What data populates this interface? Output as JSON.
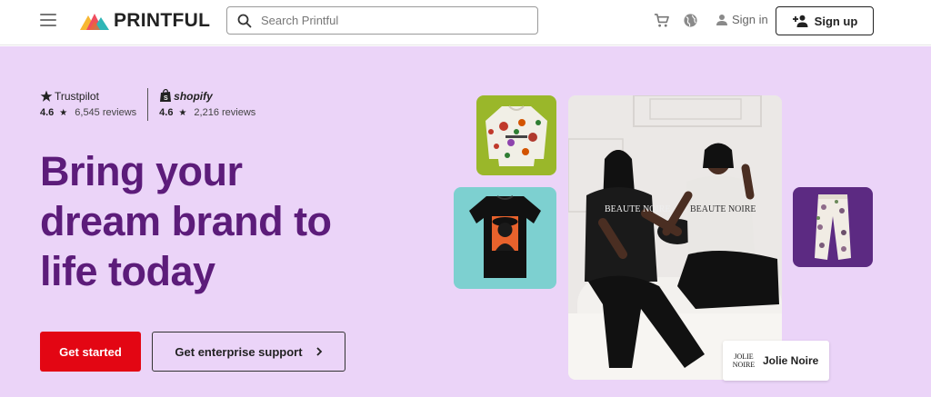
{
  "header": {
    "logo_text": "PRINTFUL",
    "search": {
      "placeholder": "Search Printful"
    },
    "sign_in_label": "Sign in",
    "sign_up_label": "Sign up"
  },
  "hero": {
    "ratings": [
      {
        "brand": "Trustpilot",
        "score": "4.6",
        "reviews": "6,545 reviews"
      },
      {
        "brand": "shopify",
        "score": "4.6",
        "reviews": "2,216 reviews"
      }
    ],
    "headline_lines": [
      "Bring your",
      "dream brand to",
      "life today"
    ],
    "cta_primary": "Get started",
    "cta_secondary": "Get enterprise support",
    "photo_shirt_texts": [
      "BEAUTE NOIRE",
      "BEAUTE NOIRE"
    ],
    "brand_card": {
      "logo_text": "JOLIE NOIRE",
      "name": "Jolie Noire"
    }
  },
  "colors": {
    "hero_bg": "#ebd4f8",
    "headline": "#5c1c7a",
    "primary_button": "#e30613",
    "sweater_tile": "#9ab72a",
    "tee_tile": "#7dd0d0",
    "pants_tile": "#5c2a82"
  },
  "icons": [
    "menu-icon",
    "search-icon",
    "cart-icon",
    "globe-icon",
    "user-icon",
    "add-user-icon",
    "star-icon",
    "shopify-bag-icon",
    "chevron-right-icon"
  ]
}
